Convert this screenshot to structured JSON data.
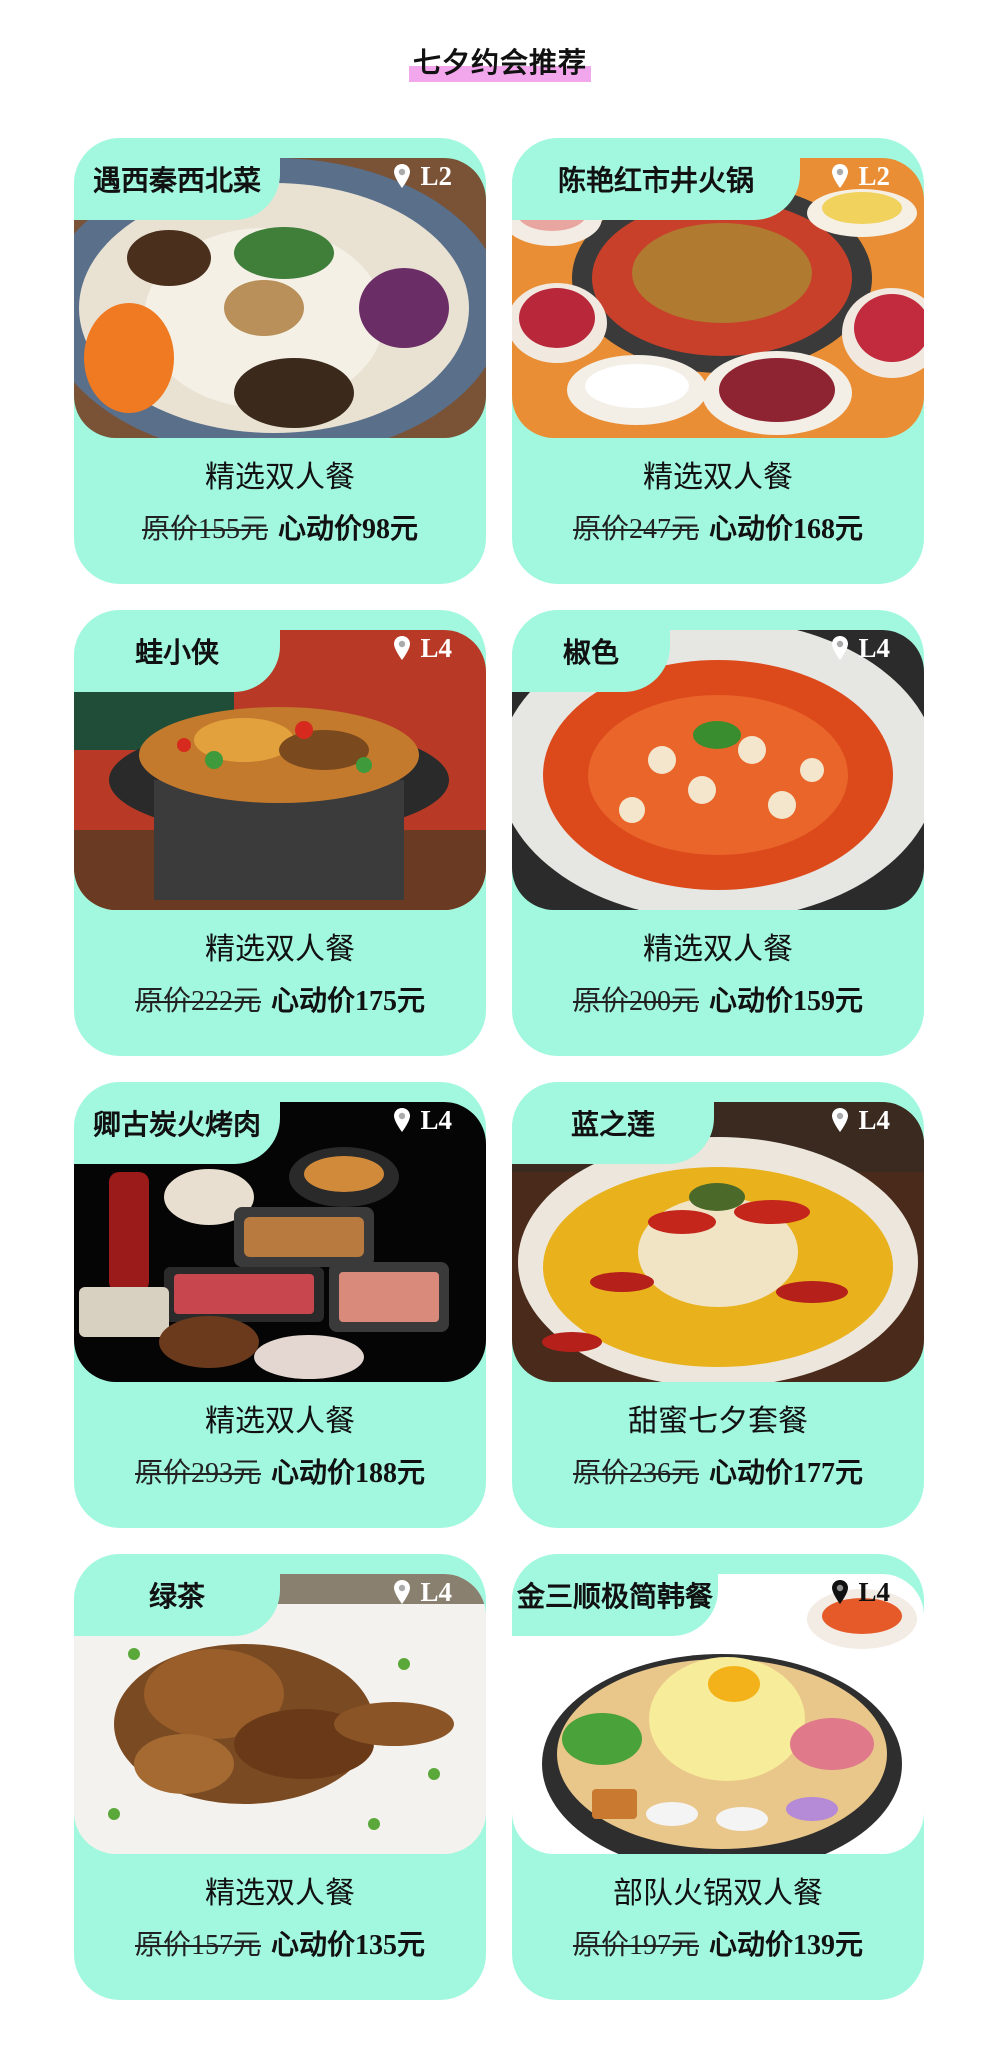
{
  "page": {
    "title": "七夕约会推荐"
  },
  "colors": {
    "card_bg": "#a2f8de",
    "title_highlight": "#f2a6ec"
  },
  "cards": [
    {
      "name": "遇西秦西北菜",
      "floor": "L2",
      "package": "精选双人餐",
      "original_price": "原价155元",
      "deal_price": "心动价98元",
      "icon": "location-pin-icon"
    },
    {
      "name": "陈艳红市井火锅",
      "floor": "L2",
      "package": "精选双人餐",
      "original_price": "原价247元",
      "deal_price": "心动价168元",
      "icon": "location-pin-icon"
    },
    {
      "name": "蛙小侠",
      "floor": "L4",
      "package": "精选双人餐",
      "original_price": "原价222元",
      "deal_price": "心动价175元",
      "icon": "location-pin-icon"
    },
    {
      "name": "椒色",
      "floor": "L4",
      "package": "精选双人餐",
      "original_price": "原价200元",
      "deal_price": "心动价159元",
      "icon": "location-pin-icon"
    },
    {
      "name": "卿古炭火烤肉",
      "floor": "L4",
      "package": "精选双人餐",
      "original_price": "原价293元",
      "deal_price": "心动价188元",
      "icon": "location-pin-icon"
    },
    {
      "name": "蓝之莲",
      "floor": "L4",
      "package": "甜蜜七夕套餐",
      "original_price": "原价236元",
      "deal_price": "心动价177元",
      "icon": "location-pin-icon"
    },
    {
      "name": "绿茶",
      "floor": "L4",
      "package": "精选双人餐",
      "original_price": "原价157元",
      "deal_price": "心动价135元",
      "icon": "location-pin-icon"
    },
    {
      "name": "金三顺极简韩餐",
      "floor": "L4",
      "package": "部队火锅双人餐",
      "original_price": "原价197元",
      "deal_price": "心动价139元",
      "icon": "location-pin-icon"
    }
  ]
}
